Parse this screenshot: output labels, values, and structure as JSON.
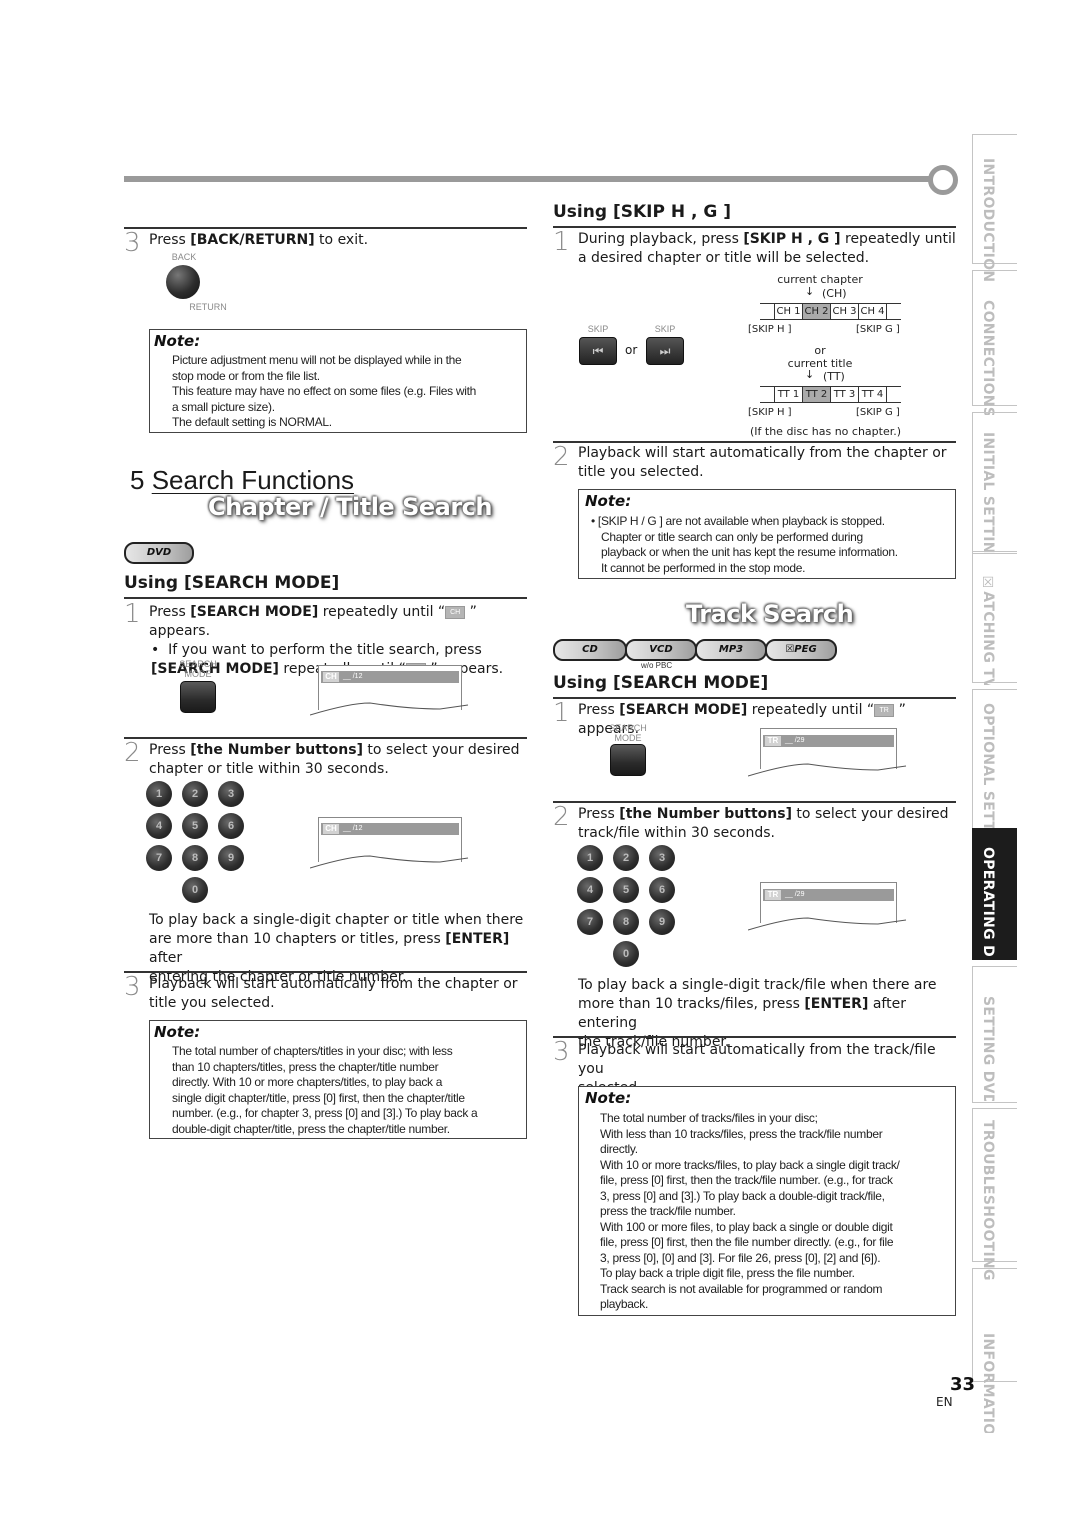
{
  "left": {
    "step3_top": {
      "num": "3",
      "text_pre": "Press ",
      "text_bold": "[BACK/RETURN]",
      "text_post": " to exit.",
      "btn_label_top": "BACK",
      "btn_label_bottom": "RETURN"
    },
    "note1": {
      "title": "Note:",
      "lines": [
        "Picture adjustment menu will not be displayed while in the",
        "stop mode or from the file list.",
        "This feature may have no effect on some files (e.g. Files with",
        "a small picture size).",
        "The default setting is  NORMAL."
      ]
    },
    "section_number": "5",
    "section_title": "Search Functions",
    "subtitle": "Chapter / Title Search",
    "disc_badge": "DVD",
    "heading": "Using [SEARCH MODE]",
    "step1": {
      "num": "1",
      "pre": "Press ",
      "bold": "[SEARCH MODE]",
      "post": " repeatedly until “",
      "chip": "CH",
      "end": " ” appears.",
      "bullet": "•",
      "sub1": "If you want to perform the title search, press",
      "sub2_bold": "[SEARCH MODE]",
      "sub2_post": " repeatedly until “",
      "sub2_chip": "TT",
      "sub2_end": " ” appears.",
      "btn_label_1": "SEARCH",
      "btn_label_2": "MODE",
      "osd_tag": "CH",
      "osd_value": "__ /12"
    },
    "step2": {
      "num": "2",
      "pre": "Press ",
      "bold": "[the Number buttons]",
      "post": " to select your desired",
      "line2": "chapter or title within 30 seconds.",
      "keys": [
        "1",
        "2",
        "3",
        "4",
        "5",
        "6",
        "7",
        "8",
        "9",
        "0"
      ],
      "osd_tag": "CH",
      "osd_value": "__ /12",
      "extra1": "To play back a single-digit chapter or title when there",
      "extra2_pre": "are more than 10 chapters or titles, press ",
      "extra2_bold": "[ENTER]",
      "extra2_post": " after",
      "extra3": "entering the chapter or title number."
    },
    "step3": {
      "num": "3",
      "line1": "Playback will start automatically from the chapter or",
      "line2": "title you selected."
    },
    "note2": {
      "title": "Note:",
      "lines": [
        "The total number of chapters/titles in your disc; with less",
        "than 10 chapters/titles, press the chapter/title number",
        "directly. With 10 or more chapters/titles, to play back a",
        "single digit chapter/title, press [0] first, then the chapter/title",
        "number. (e.g., for chapter 3, press [0] and [3].) To play back a",
        "double-digit chapter/title, press the chapter/title number."
      ]
    }
  },
  "right": {
    "heading_skip": "Using [SKIP H   , G   ]",
    "skip_step1": {
      "num": "1",
      "pre": "During playback, press ",
      "bold": "[SKIP",
      "mid": " H   , G   ]",
      "post": " repeatedly until",
      "line2": "a desired chapter or title will be selected.",
      "btn_label": "SKIP",
      "or": "or",
      "prev_glyph": "⏮",
      "next_glyph": "⏭"
    },
    "diagram": {
      "current_chapter": "current chapter",
      "ch_abbr": "(CH)",
      "chapters": [
        "CH 1",
        "CH 2",
        "CH 3",
        "CH 4"
      ],
      "selected_chapter": 1,
      "skip_prev": "[SKIP H   ]",
      "skip_next": "[SKIP G   ]",
      "or": "or",
      "current_title": "current title",
      "tt_abbr": "(TT)",
      "titles": [
        "TT 1",
        "TT 2",
        "TT 3",
        "TT 4"
      ],
      "selected_title": 1,
      "footnote": "(If the disc has no chapter.)"
    },
    "skip_step2": {
      "num": "2",
      "line1": "Playback will start automatically from the chapter or",
      "line2": "title you selected."
    },
    "note3": {
      "title": "Note:",
      "lines": [
        "• [SKIP H    / G    ] are not available when playback is stopped.",
        "Chapter or title search can only be performed during",
        "playback or when the unit has kept the resume information.",
        "It cannot be performed in the stop mode."
      ]
    },
    "track_title": "Track Search",
    "disc_badges": [
      "CD",
      "VCD",
      "MP3",
      "☒PEG"
    ],
    "vcd_sub": "w/o PBC",
    "heading": "Using [SEARCH MODE]",
    "step1": {
      "num": "1",
      "pre": "Press ",
      "bold": "[SEARCH MODE]",
      "post": " repeatedly until “",
      "chip": "TR",
      "end": " ” appears.",
      "btn_label_1": "SEARCH",
      "btn_label_2": "MODE",
      "osd_tag": "TR",
      "osd_value": "__ /29"
    },
    "step2": {
      "num": "2",
      "pre": "Press ",
      "bold": "[the Number buttons]",
      "post": " to select your desired",
      "line2": "track/file within 30 seconds.",
      "keys": [
        "1",
        "2",
        "3",
        "4",
        "5",
        "6",
        "7",
        "8",
        "9",
        "0"
      ],
      "osd_tag": "TR",
      "osd_value": "__ /29",
      "extra1": "To play back a single-digit track/file when there are",
      "extra2_pre": "more than 10 tracks/files, press ",
      "extra2_bold": "[ENTER]",
      "extra2_post": " after entering",
      "extra3": "the track/file number."
    },
    "step3": {
      "num": "3",
      "line1": "Playback will start automatically from the track/file you",
      "line2": "selected."
    },
    "note4": {
      "title": "Note:",
      "lines": [
        "The total number of tracks/files in your disc;",
        "With less than 10 tracks/files, press the track/file number",
        "directly.",
        "With 10 or more tracks/files, to play back a single digit track/",
        "file, press [0] first, then the track/file number. (e.g., for track",
        "3, press [0] and [3].) To play back a double-digit track/file,",
        "press the track/file number.",
        "With 100 or more files, to play back a single or double digit",
        "file, press [0] first, then the file number directly. (e.g., for file",
        "3, press [0], [0] and [3]. For file 26, press [0], [2] and [6]).",
        "To play back a triple digit file, press the file number.",
        "Track search is not available for programmed or random",
        "playback."
      ]
    }
  },
  "side_tabs": [
    {
      "label": "INTRODUCTION",
      "active": false
    },
    {
      "label": "CONNECTIONS",
      "active": false
    },
    {
      "label": "INITIAL SETTING",
      "active": false
    },
    {
      "label": "☒ATCHING TV",
      "active": false
    },
    {
      "label": "OPTIONAL SETTI",
      "active": false
    },
    {
      "label": "OPERATING D",
      "active": true
    },
    {
      "label": "SETTING DVD",
      "active": false
    },
    {
      "label": "TROUBLESHOOTING",
      "active": false
    },
    {
      "label": "INFORMATIO",
      "active": false
    }
  ],
  "footer": {
    "page_number": "33",
    "language": "EN"
  }
}
